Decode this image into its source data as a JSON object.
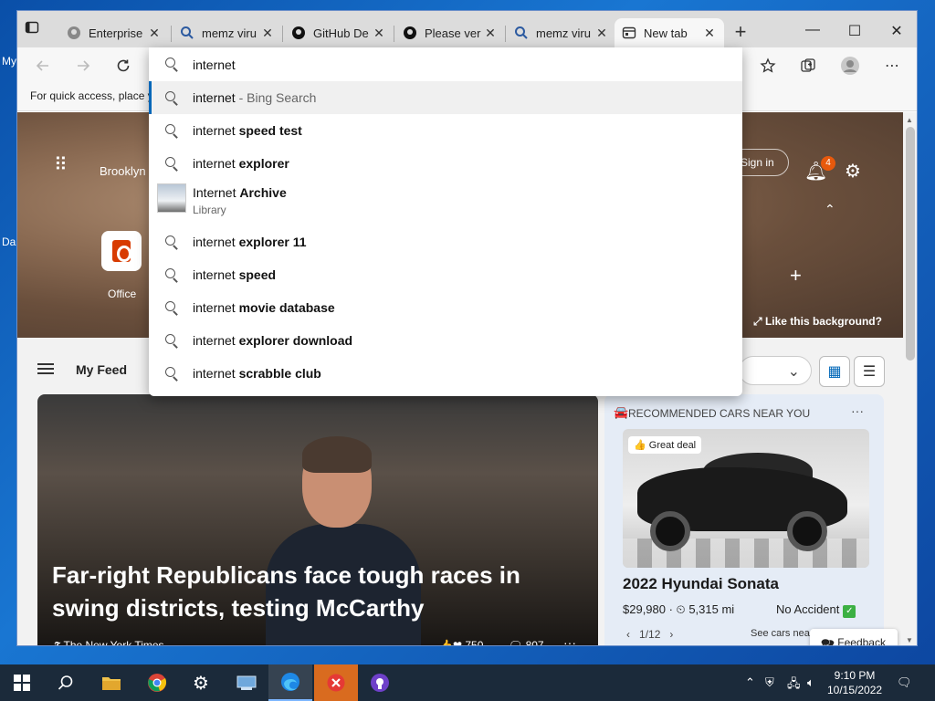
{
  "desktop": {
    "labels": [
      "My",
      "Da"
    ]
  },
  "tabs": [
    {
      "title": "Enterprise",
      "icon": "github-icon"
    },
    {
      "title": "memz viru",
      "icon": "search-icon"
    },
    {
      "title": "GitHub De",
      "icon": "github-icon"
    },
    {
      "title": "Please ver",
      "icon": "github-icon"
    },
    {
      "title": "memz viru",
      "icon": "search-icon"
    },
    {
      "title": "New tab",
      "icon": "newtab-icon",
      "active": true
    }
  ],
  "tab_close_glyph": "✕",
  "new_tab_glyph": "+",
  "window_controls": {
    "minimize": "—",
    "maximize": "☐",
    "close": "✕"
  },
  "favorites_bar": {
    "text": "For quick access, place y"
  },
  "omnibox": {
    "value": "internet",
    "suggestions": [
      {
        "prefix": "internet",
        "suffix": " - Bing Search",
        "style": "muted",
        "selected": true
      },
      {
        "prefix": "internet ",
        "bold": "speed test"
      },
      {
        "prefix": "internet ",
        "bold": "explorer"
      },
      {
        "prefix": "Internet ",
        "bold": "Archive",
        "subtitle": "Library",
        "thumbnail": true
      },
      {
        "prefix": "internet ",
        "bold": "explorer 11"
      },
      {
        "prefix": "internet ",
        "bold": "speed"
      },
      {
        "prefix": "internet ",
        "bold": "movie database"
      },
      {
        "prefix": "internet ",
        "bold": "explorer download"
      },
      {
        "prefix": "internet ",
        "bold": "scrabble club"
      }
    ]
  },
  "hero": {
    "city": "Brooklyn",
    "sign_in": "Sign in",
    "notification_count": "4",
    "app_tile": "Office",
    "like_background": "Like this background?"
  },
  "feed": {
    "title": "My Feed"
  },
  "main_article": {
    "headline": "Far-right Republicans face tough races in swing districts, testing McCarthy",
    "source": "The New York Times",
    "reactions": "750",
    "comments": "807",
    "more": "···"
  },
  "cars_card": {
    "header": "RECOMMENDED CARS NEAR YOU",
    "badge": "Great deal",
    "title": "2022 Hyundai Sonata",
    "price": "$29,980 · ",
    "mileage": "5,315 mi",
    "accident": "No Accident",
    "pager": "1/12",
    "see_cars": "See cars nea",
    "more": "···"
  },
  "feedback": {
    "label": "Feedback"
  },
  "taskbar": {
    "time": "9:10 PM",
    "date": "10/15/2022"
  },
  "colors": {
    "accent": "#0067b8",
    "badge": "#e8590c",
    "taskbar": "#1b2a3a"
  }
}
